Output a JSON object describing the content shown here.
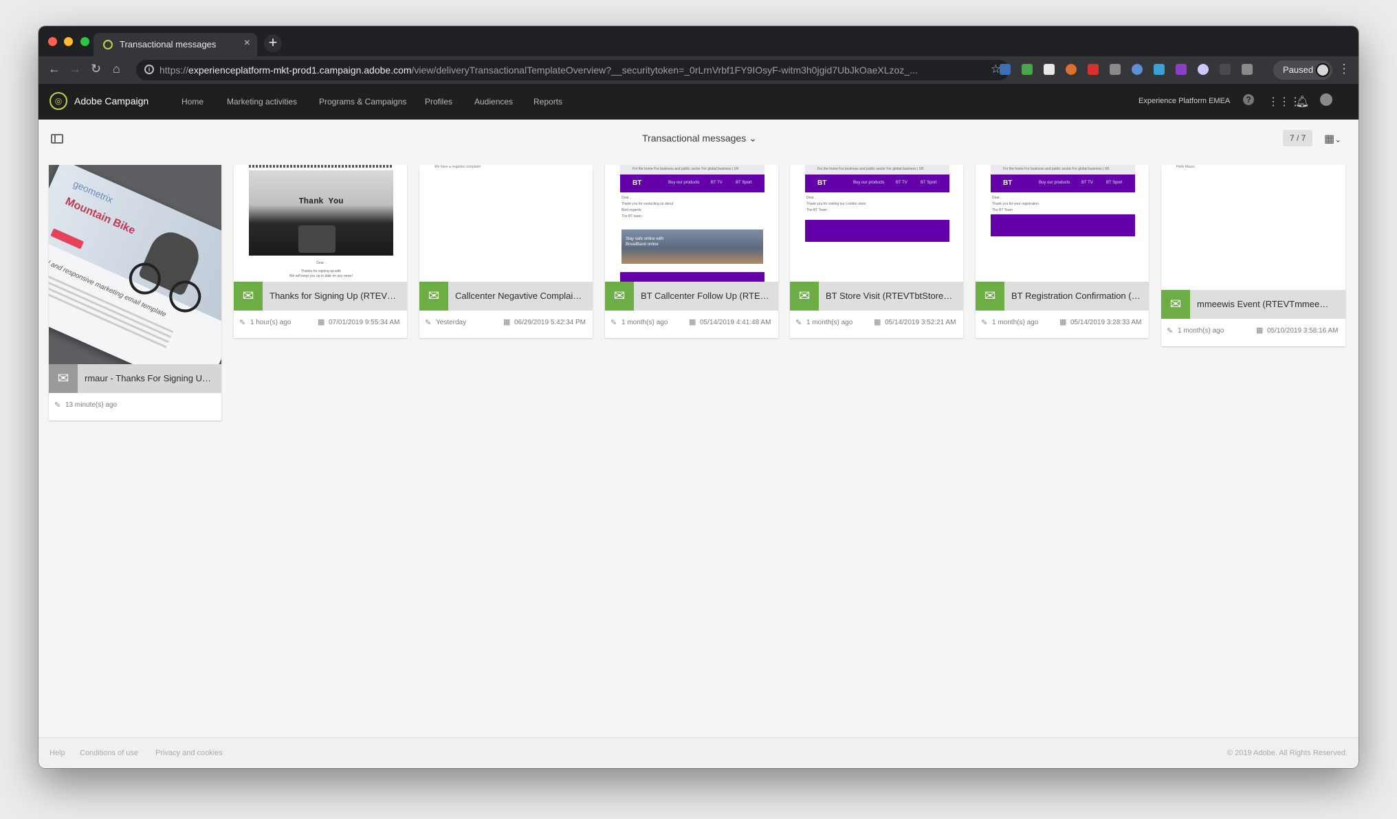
{
  "browser": {
    "tab_title": "Transactional messages",
    "tab_close": "×",
    "new_tab": "+",
    "url_prefix": "https://",
    "url_host": "experienceplatform-mkt-prod1.campaign.adobe.com",
    "url_path": "/view/deliveryTransactionalTemplateOverview?__securitytoken=_0rLrnVrbf1FY9IOsyF-witm3h0jgid7UbJkOaeXLzoz_...",
    "profile_status": "Paused"
  },
  "app": {
    "name": "Adobe Campaign",
    "nav": [
      "Home",
      "Marketing activities",
      "Programs & Campaigns",
      "Profiles",
      "Audiences",
      "Reports"
    ],
    "org": "Experience Platform EMEA",
    "help_icon": "?"
  },
  "view": {
    "title": "Transactional messages",
    "count": "7 / 7"
  },
  "cards": [
    {
      "title": "rmaur - Thanks For Signing Up ...",
      "modified": "13 minute(s) ago",
      "created": "",
      "icon": "gray"
    },
    {
      "title": "Thanks for Signing Up (RTEVTt...",
      "modified": "1 hour(s) ago",
      "created": "07/01/2019 9:55:34 AM",
      "icon": "green"
    },
    {
      "title": "Callcenter Negavtive Complaint...",
      "modified": "Yesterday",
      "created": "06/29/2019 5:42:34 PM",
      "icon": "green"
    },
    {
      "title": "BT Callcenter Follow Up (RTEV...",
      "modified": "1 month(s) ago",
      "created": "05/14/2019 4:41:48 AM",
      "icon": "green"
    },
    {
      "title": "BT Store Visit (RTEVTbtStoreVisit)",
      "modified": "1 month(s) ago",
      "created": "05/14/2019 3:52:21 AM",
      "icon": "green"
    },
    {
      "title": "BT Registration Confirmation (R...",
      "modified": "1 month(s) ago",
      "created": "05/14/2019 3:28:33 AM",
      "icon": "green"
    },
    {
      "title": "mmeewis Event (RTEVTmmeewis...",
      "modified": "1 month(s) ago",
      "created": "05/10/2019 3:58:16 AM",
      "icon": "green"
    }
  ],
  "thumbs": {
    "mountain": {
      "brand": "geometrix",
      "headline": "Mountain Bike",
      "tagline": "optional and responsive marketing email template"
    },
    "thankyou": {
      "headline": "Thank You",
      "dear": "Dear ,",
      "line1": "Thanks for signing up with",
      "line2": "We will keep you up to date on any news!"
    },
    "callcenter": {
      "line1": "We have a negative complaint"
    },
    "bt": {
      "top_links": "For the home     For business and public sector     For global business  |  UK",
      "logo": "BT",
      "menu": [
        "Buy our products",
        "BT TV",
        "BT Sport"
      ],
      "dear": "Dear ,",
      "followup_lines": [
        "Thank you for contacting us about",
        "Best regards,",
        "The BT team"
      ],
      "followup_banner": "Stay safe online with BroadBand online",
      "store_lines": [
        "Thank you for visiting our London store.",
        "The BT Team"
      ],
      "reg_lines": [
        "Thank you for your registration.",
        "The BT Team"
      ]
    },
    "mmeewis": {
      "line1": "Hello Mauro"
    }
  },
  "footer": {
    "links": [
      "Help",
      "Conditions of use",
      "Privacy and cookies"
    ],
    "copyright": "© 2019 Adobe. All Rights Reserved."
  },
  "colors": {
    "accent_green": "#6cae45",
    "bt_purple": "#6400aa",
    "header_bg": "#1f1f1f"
  },
  "icons": {
    "type": "transactional-email-icon",
    "modified": "pencil-icon",
    "created": "calendar-icon"
  }
}
